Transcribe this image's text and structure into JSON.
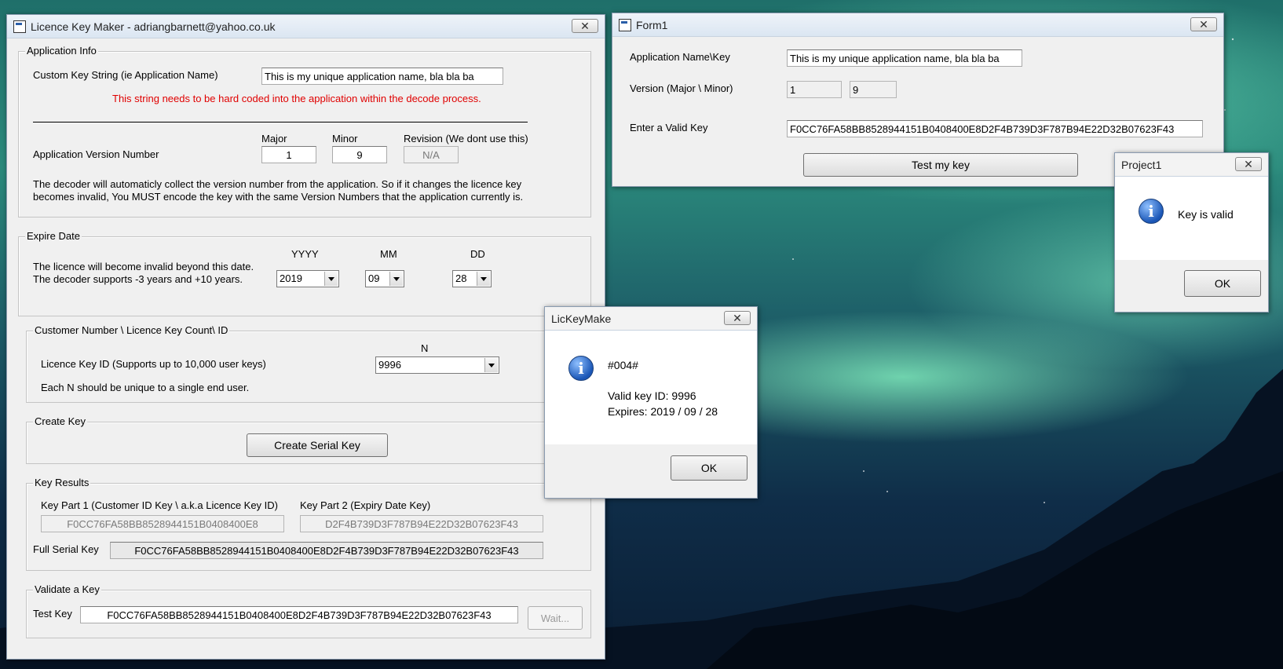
{
  "main_window": {
    "title": "Licence Key Maker - adriangbarnett@yahoo.co.uk",
    "close_glyph": "✕",
    "app_info": {
      "title": "Application Info",
      "custom_key_label": "Custom Key String (ie Application Name)",
      "custom_key_value": "This is my unique application name, bla bla ba",
      "warning": "This string needs to be hard coded into the application within the decode process.",
      "version_label": "Application Version Number",
      "major_label": "Major",
      "minor_label": "Minor",
      "revision_label": "Revision (We dont use this)",
      "major_value": "1",
      "minor_value": "9",
      "revision_value": "N/A",
      "note_line1": "The decoder will automaticly collect the version number from the application. So if it changes the licence key",
      "note_line2": "becomes invalid, You MUST encode the key with the same Version Numbers that the application currently is."
    },
    "expire": {
      "title": "Expire Date",
      "line1": "The licence will become invalid beyond this date.",
      "line2": "The decoder supports -3 years and +10 years.",
      "yyyy_label": "YYYY",
      "mm_label": "MM",
      "dd_label": "DD",
      "yyyy_value": "2019",
      "mm_value": "09",
      "dd_value": "28"
    },
    "customer": {
      "title": "Customer Number \\ Licence Key Count\\ ID",
      "n_label": "N",
      "id_label": "Licence Key ID (Supports up to 10,000 user keys)",
      "id_value": "9996",
      "note": "Each N should be unique to a single end user."
    },
    "create": {
      "title": "Create Key",
      "button": "Create Serial Key"
    },
    "results": {
      "title": "Key Results",
      "part1_label": "Key Part 1 (Customer ID Key \\ a.k.a Licence Key ID)",
      "part2_label": "Key Part 2 (Expiry Date Key)",
      "part1_value": "F0CC76FA58BB8528944151B0408400E8",
      "part2_value": "D2F4B739D3F787B94E22D32B07623F43",
      "full_label": "Full Serial Key",
      "full_value": "F0CC76FA58BB8528944151B0408400E8D2F4B739D3F787B94E22D32B07623F43"
    },
    "validate": {
      "title": "Validate a Key",
      "test_label": "Test Key",
      "test_value": "F0CC76FA58BB8528944151B0408400E8D2F4B739D3F787B94E22D32B07623F43",
      "wait_button": "Wait..."
    }
  },
  "form1": {
    "title": "Form1",
    "close_glyph": "✕",
    "app_label": "Application Name\\Key",
    "app_value": "This is my unique application name, bla bla ba",
    "version_label": "Version (Major \\ Minor)",
    "major_value": "1",
    "minor_value": "9",
    "key_label": "Enter a Valid Key",
    "key_value": "F0CC76FA58BB8528944151B0408400E8D2F4B739D3F787B94E22D32B07623F43",
    "test_button": "Test my key"
  },
  "project1": {
    "title": "Project1",
    "close_glyph": "✕",
    "icon_glyph": "i",
    "message": "Key is valid",
    "ok": "OK"
  },
  "lickey": {
    "title": "LicKeyMake",
    "close_glyph": "✕",
    "icon_glyph": "i",
    "line1": "#004#",
    "line2": "Valid key ID: 9996",
    "line3": "Expires: 2019 / 09 / 28",
    "ok": "OK"
  }
}
